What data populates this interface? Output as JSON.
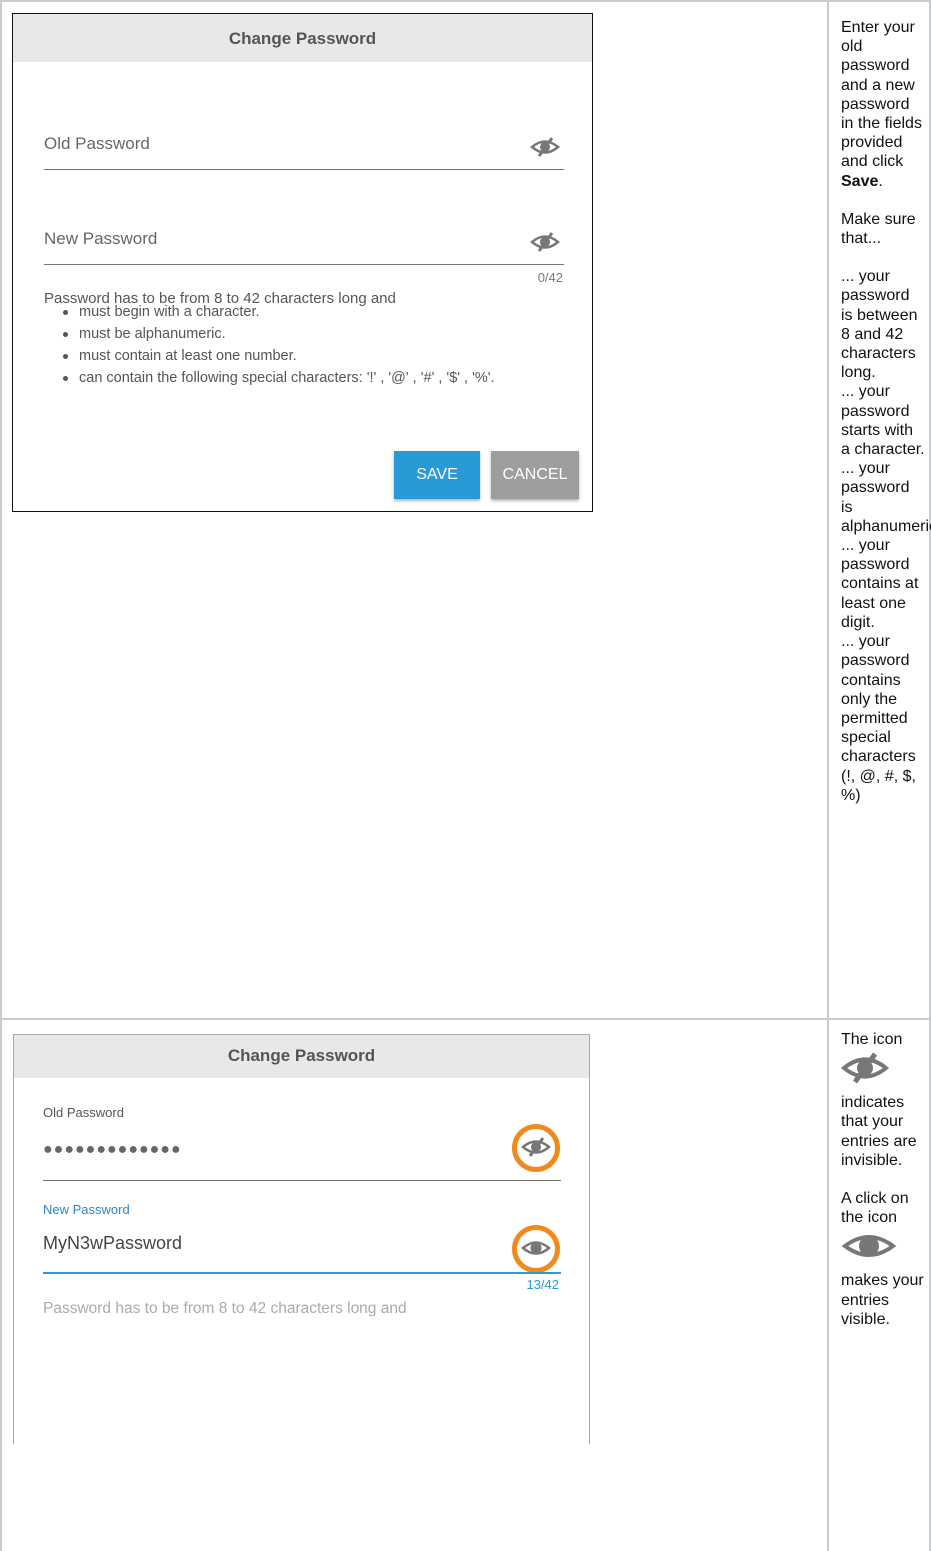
{
  "dialog1": {
    "title": "Change Password",
    "old_password_label": "Old Password",
    "new_password_label": "New Password",
    "counter": "0/42",
    "help_text": "Password has to be from 8 to 42 characters long and",
    "rules": [
      "must begin with a character.",
      "must be alphanumeric.",
      "must contain at least one number.",
      "can contain the following special characters: '!' , '@' , '#' , '$' , '%'."
    ],
    "save_label": "SAVE",
    "cancel_label": "CANCEL"
  },
  "side1": {
    "intro_before": "Enter your old password and a new password in the fields provided and click ",
    "intro_bold": "Save",
    "intro_after": ".",
    "make_sure": "Make sure that...",
    "items": [
      "... your password is between 8 and 42 characters long.",
      "... your password starts with a character.",
      "... your password is alphanumeric.",
      "... your password contains at least one digit.",
      "... your password contains only the permitted special characters (!, @, #, $, %)"
    ]
  },
  "dialog2": {
    "title": "Change Password",
    "old_password_label": "Old Password",
    "old_password_value": "●●●●●●●●●●●●●",
    "new_password_label": "New Password",
    "new_password_value": "MyN3wPassword",
    "counter": "13/42",
    "help_text": "Password has to be from 8 to 42 characters long and"
  },
  "side2": {
    "line1": "The icon",
    "line2": "indicates that your entries are invisible.",
    "line3": "A click on the icon",
    "line4": "makes your entries visible."
  },
  "colors": {
    "accent": "#2a9ad6",
    "highlight_ring": "#f08a1e",
    "cancel": "#9e9e9e"
  },
  "icons": [
    "eye-slash-icon",
    "eye-icon"
  ]
}
